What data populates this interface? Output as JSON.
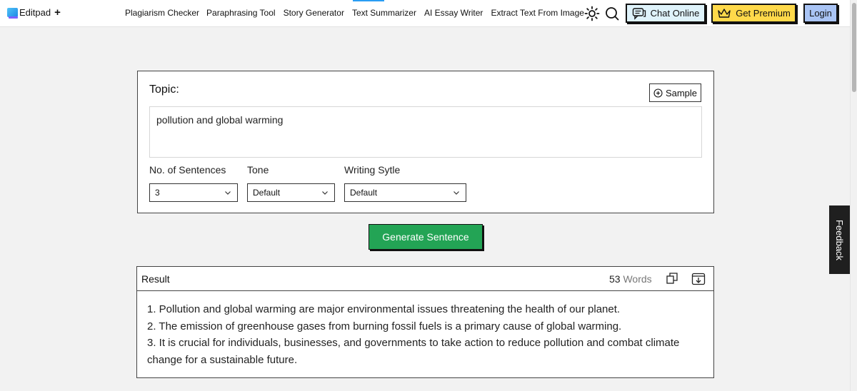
{
  "header": {
    "brand": "Editpad",
    "brand_plus": "+",
    "nav": [
      "Plagiarism Checker",
      "Paraphrasing Tool",
      "Story Generator",
      "Text Summarizer",
      "AI Essay Writer",
      "Extract Text From Image"
    ],
    "chat_label": "Chat Online",
    "premium_label": "Get Premium",
    "login_label": "Login",
    "icons": [
      "sun-icon",
      "search-icon",
      "chat-icon",
      "crown-icon"
    ]
  },
  "form": {
    "topic_label": "Topic:",
    "sample_label": "Sample",
    "topic_value": "pollution and global warming",
    "sentences_label": "No. of Sentences",
    "sentences_value": "3",
    "tone_label": "Tone",
    "tone_value": "Default",
    "style_label": "Writing Sytle",
    "style_value": "Default"
  },
  "generate_label": "Generate Sentence",
  "result": {
    "title": "Result",
    "word_count": "53",
    "word_unit": "Words",
    "lines": [
      "1. Pollution and global warming are major environmental issues threatening the health of our planet.",
      "2. The emission of greenhouse gases from burning fossil fuels is a primary cause of global warming.",
      "3. It is crucial for individuals, businesses, and governments to take action to reduce pollution and combat climate change for a sustainable future."
    ]
  },
  "feedback_label": "Feedback",
  "colors": {
    "generate": "#23a455",
    "premium": "#ffd94a",
    "login": "#a9c4f5",
    "chat": "#dff3fb",
    "background": "#f2f2f2"
  }
}
